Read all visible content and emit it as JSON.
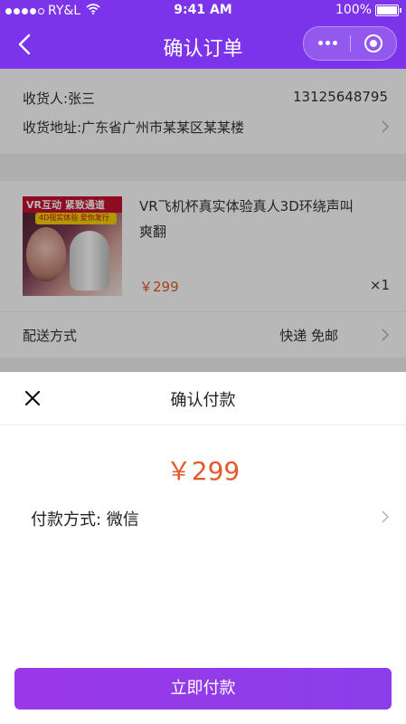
{
  "status_bar": {
    "carrier": "RY&L",
    "time": "9:41 AM",
    "battery": "100%"
  },
  "nav": {
    "title": "确认订单"
  },
  "address": {
    "consignee": "收货人:张三",
    "phone": "13125648795",
    "address": "收货地址:广东省广州市某某区某某楼"
  },
  "product": {
    "title": "VR飞机杯真实体验真人3D环绕声叫爽翻",
    "price": "￥299",
    "quantity": "×1",
    "image_text_1": "VR互动 紧致通道",
    "image_text_2": "4D视实体验 爱你发行"
  },
  "delivery": {
    "label": "配送方式",
    "value": "快递 免邮"
  },
  "payment_sheet": {
    "title": "确认付款",
    "amount": "￥299",
    "method": "付款方式: 微信",
    "pay_button": "立即付款"
  },
  "colors": {
    "accent": "#7c34ea",
    "price": "#e8572b",
    "button": "#9b38e8"
  }
}
